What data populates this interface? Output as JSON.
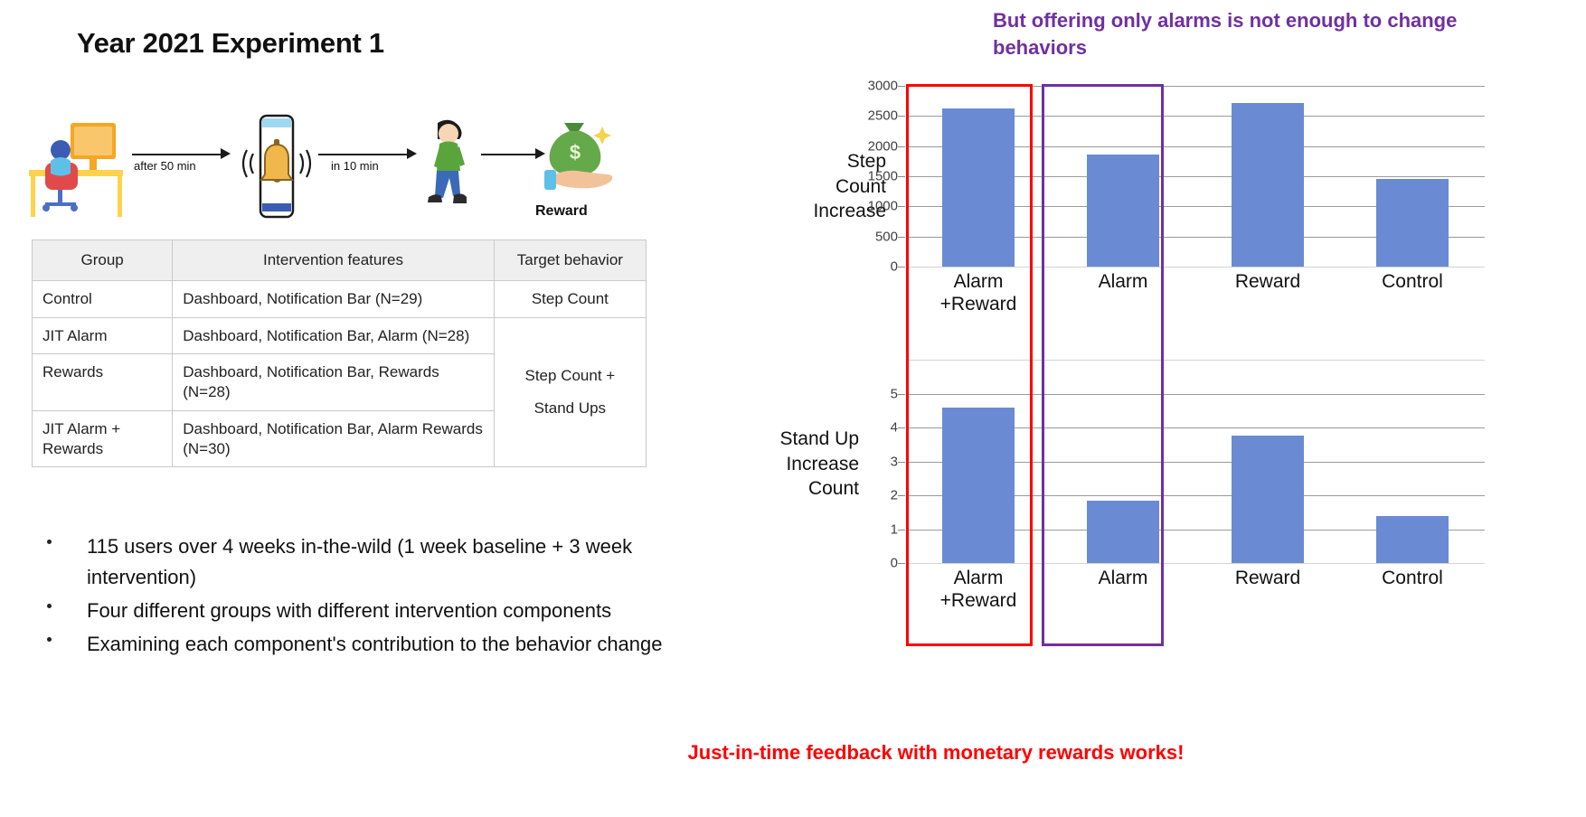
{
  "slide": {
    "title": "Year 2021 Experiment 1"
  },
  "flow": {
    "steps": [
      {
        "icon": "desk-worker-icon",
        "label": ""
      },
      {
        "icon": "phone-alarm-bell-icon",
        "label": ""
      },
      {
        "icon": "walking-person-icon",
        "label": ""
      },
      {
        "icon": "money-bag-reward-icon",
        "label": "Reward"
      }
    ],
    "arrow1_label": "after 50 min",
    "arrow2_label": "in 10 min",
    "reward_caption": "Reward"
  },
  "table": {
    "headers": [
      "Group",
      "Intervention features",
      "Target behavior"
    ],
    "rows": [
      {
        "group": "Control",
        "features": "Dashboard, Notification Bar (N=29)",
        "target": "Step Count"
      },
      {
        "group": "JIT Alarm",
        "features": "Dashboard, Notification Bar, Alarm (N=28)",
        "target": ""
      },
      {
        "group": "Rewards",
        "features": "Dashboard, Notification Bar, Rewards (N=28)",
        "target": "Step Count +\nStand Ups"
      },
      {
        "group": "JIT Alarm + Rewards",
        "features": "Dashboard, Notification Bar, Alarm Rewards (N=30)",
        "target": ""
      }
    ],
    "merged_target_label_line1": "Step Count +",
    "merged_target_label_line2": "Stand Ups"
  },
  "bullets": [
    "115 users over 4 weeks in-the-wild\n(1 week baseline + 3 week intervention)",
    "Four different groups with different\nintervention components",
    "Examining each component's contribution to\nthe behavior change"
  ],
  "annotations": {
    "purple_note": "But offering only alarms is not enough to change behaviors",
    "red_note": "Just-in-time feedback with monetary rewards works!",
    "purple_color": "#7030a0",
    "red_color": "#ff0000",
    "bar_color": "#6a8ad4"
  },
  "chart_data": [
    {
      "type": "bar",
      "title": "",
      "ylabel": "Step Count Increase",
      "xlabel": "",
      "categories": [
        "Alarm +Reward",
        "Alarm",
        "Reward",
        "Control"
      ],
      "category_lines": [
        [
          "Alarm",
          "+Reward"
        ],
        [
          "Alarm"
        ],
        [
          "Reward"
        ],
        [
          "Control"
        ]
      ],
      "values": [
        2620,
        1860,
        2720,
        1450
      ],
      "ylim": [
        0,
        3000
      ],
      "yticks": [
        0,
        500,
        1000,
        1500,
        2000,
        2500,
        3000
      ],
      "ytick_labels": [
        "0",
        "500",
        "1000",
        "1500",
        "2000",
        "2500",
        "3000"
      ],
      "grid": true,
      "legend": "none",
      "highlight_red": [
        "Alarm +Reward"
      ],
      "highlight_purple": [
        "Alarm"
      ]
    },
    {
      "type": "bar",
      "title": "",
      "ylabel": "Stand Up Increase Count",
      "xlabel": "",
      "categories": [
        "Alarm +Reward",
        "Alarm",
        "Reward",
        "Control"
      ],
      "category_lines": [
        [
          "Alarm",
          "+Reward"
        ],
        [
          "Alarm"
        ],
        [
          "Reward"
        ],
        [
          "Control"
        ]
      ],
      "values": [
        4.6,
        1.85,
        3.75,
        1.4
      ],
      "ylim": [
        0,
        6
      ],
      "yticks": [
        0,
        1,
        2,
        3,
        4,
        5
      ],
      "ytick_labels": [
        "0",
        "1",
        "2",
        "3",
        "4",
        "5"
      ],
      "grid": true,
      "legend": "none",
      "highlight_red": [
        "Alarm +Reward"
      ],
      "highlight_purple": [
        "Alarm"
      ]
    }
  ],
  "axis_titles": {
    "top_line1": "Step",
    "top_line2": "Count",
    "top_line3": "Increase",
    "bottom_line1": "Stand Up",
    "bottom_line2": "Increase",
    "bottom_line3": "Count"
  }
}
